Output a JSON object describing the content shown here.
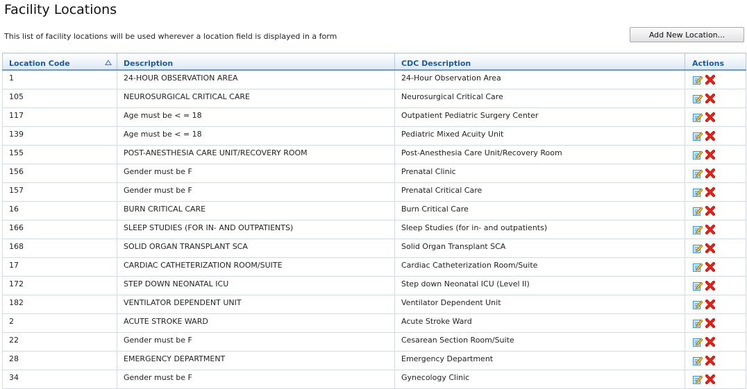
{
  "page": {
    "title": "Facility Locations",
    "intro": "This list of facility locations will be used wherever a location field is displayed in a form",
    "add_button": "Add New Location..."
  },
  "table": {
    "headers": {
      "code": "Location Code",
      "description": "Description",
      "cdc": "CDC Description",
      "actions": "Actions"
    },
    "sorted_by": "Location Code",
    "sort_direction": "ascending",
    "row_actions": [
      "edit-icon",
      "delete-icon"
    ],
    "colors": {
      "header_text": "#1d5b9a",
      "delete": "#e0261c",
      "edit": "#3d8fd6"
    },
    "rows": [
      {
        "code": "1",
        "description": "24-HOUR OBSERVATION AREA",
        "cdc": "24-Hour Observation Area"
      },
      {
        "code": "105",
        "description": "NEUROSURGICAL CRITICAL CARE",
        "cdc": "Neurosurgical Critical Care"
      },
      {
        "code": "117",
        "description": "Age must be < = 18",
        "cdc": "Outpatient Pediatric Surgery Center"
      },
      {
        "code": "139",
        "description": "Age must be < = 18",
        "cdc": "Pediatric Mixed Acuity Unit"
      },
      {
        "code": "155",
        "description": "POST-ANESTHESIA CARE UNIT/RECOVERY ROOM",
        "cdc": "Post-Anesthesia Care Unit/Recovery Room"
      },
      {
        "code": "156",
        "description": "Gender must be F",
        "cdc": "Prenatal Clinic"
      },
      {
        "code": "157",
        "description": "Gender must be F",
        "cdc": "Prenatal Critical Care"
      },
      {
        "code": "16",
        "description": "BURN CRITICAL CARE",
        "cdc": "Burn Critical Care"
      },
      {
        "code": "166",
        "description": "SLEEP STUDIES (FOR IN- AND OUTPATIENTS)",
        "cdc": "Sleep Studies (for in- and outpatients)"
      },
      {
        "code": "168",
        "description": "SOLID ORGAN TRANSPLANT SCA",
        "cdc": "Solid Organ Transplant SCA"
      },
      {
        "code": "17",
        "description": "CARDIAC CATHETERIZATION ROOM/SUITE",
        "cdc": "Cardiac Catheterization Room/Suite"
      },
      {
        "code": "172",
        "description": "STEP DOWN NEONATAL ICU",
        "cdc": "Step down Neonatal ICU (Level II)"
      },
      {
        "code": "182",
        "description": "VENTILATOR DEPENDENT UNIT",
        "cdc": "Ventilator Dependent Unit"
      },
      {
        "code": "2",
        "description": "ACUTE STROKE WARD",
        "cdc": "Acute Stroke Ward"
      },
      {
        "code": "22",
        "description": "Gender must be F",
        "cdc": "Cesarean Section Room/Suite"
      },
      {
        "code": "28",
        "description": "EMERGENCY DEPARTMENT",
        "cdc": "Emergency Department"
      },
      {
        "code": "34",
        "description": "Gender must be F",
        "cdc": "Gynecology Clinic"
      }
    ]
  }
}
